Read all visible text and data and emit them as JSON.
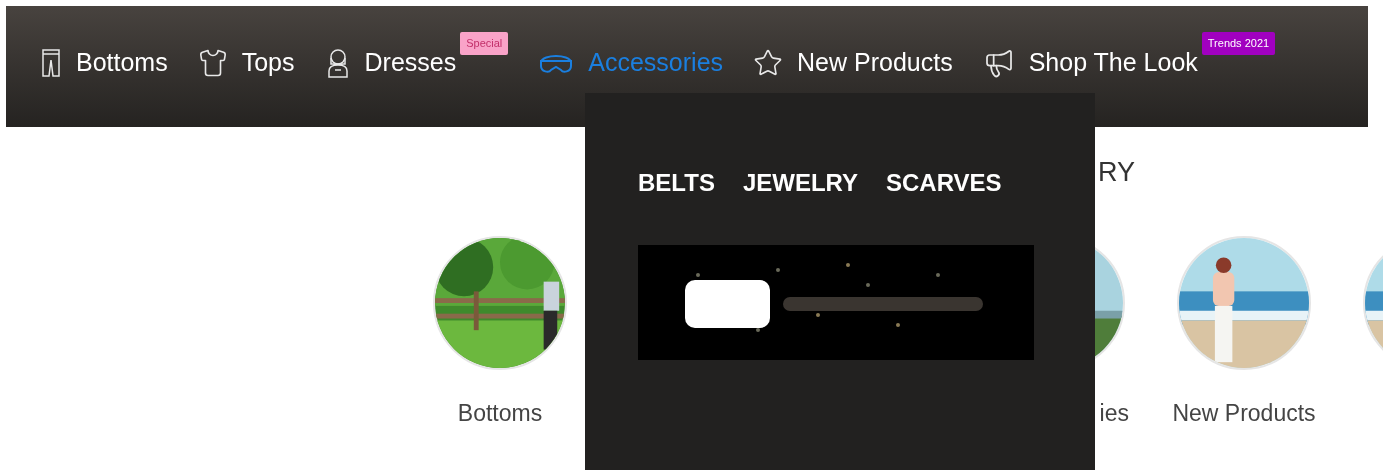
{
  "nav": {
    "items": [
      {
        "label": "Bottoms",
        "selected": false
      },
      {
        "label": "Tops",
        "selected": false
      },
      {
        "label": "Dresses",
        "selected": false,
        "badge": {
          "text": "Special",
          "color": "#f9a3c8"
        }
      },
      {
        "label": "Accessories",
        "selected": true
      },
      {
        "label": "New Products",
        "selected": false
      },
      {
        "label": "Shop The Look",
        "selected": false,
        "badge": {
          "text": "Trends 2021",
          "color": "#a100c0"
        }
      }
    ]
  },
  "mega_menu": {
    "links": [
      "BELTS",
      "JEWELRY",
      "SCARVES"
    ],
    "banner": {
      "kind": "picture"
    }
  },
  "section": {
    "heading": "RY",
    "categories": [
      {
        "label": "Bottoms",
        "kind": "picture"
      },
      {
        "label": "ies",
        "kind": "picture"
      },
      {
        "label": "New Products",
        "kind": "picture"
      },
      {
        "kind": "picture"
      }
    ]
  }
}
